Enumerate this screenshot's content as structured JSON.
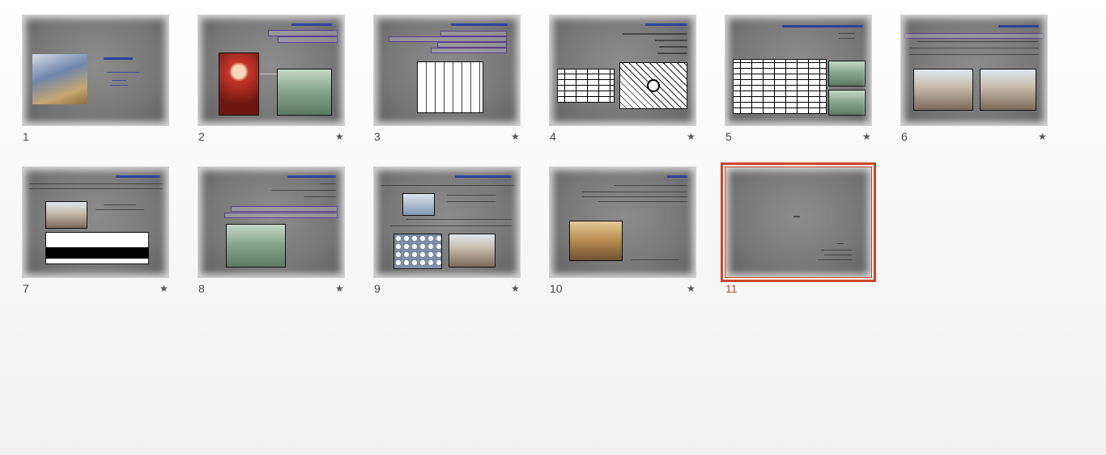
{
  "app": {
    "view": "Slide Sorter"
  },
  "colors": {
    "selection": "#c8472b",
    "slide_bg": "#7d7d7d",
    "title_text": "#2c3e9c"
  },
  "slides": [
    {
      "number": "1",
      "has_transition_star": false,
      "selected": false
    },
    {
      "number": "2",
      "has_transition_star": true,
      "selected": false
    },
    {
      "number": "3",
      "has_transition_star": true,
      "selected": false
    },
    {
      "number": "4",
      "has_transition_star": true,
      "selected": false
    },
    {
      "number": "5",
      "has_transition_star": true,
      "selected": false
    },
    {
      "number": "6",
      "has_transition_star": true,
      "selected": false
    },
    {
      "number": "7",
      "has_transition_star": true,
      "selected": false
    },
    {
      "number": "8",
      "has_transition_star": true,
      "selected": false
    },
    {
      "number": "9",
      "has_transition_star": true,
      "selected": false
    },
    {
      "number": "10",
      "has_transition_star": true,
      "selected": false
    },
    {
      "number": "11",
      "has_transition_star": false,
      "selected": true
    }
  ],
  "star_glyph": "★"
}
